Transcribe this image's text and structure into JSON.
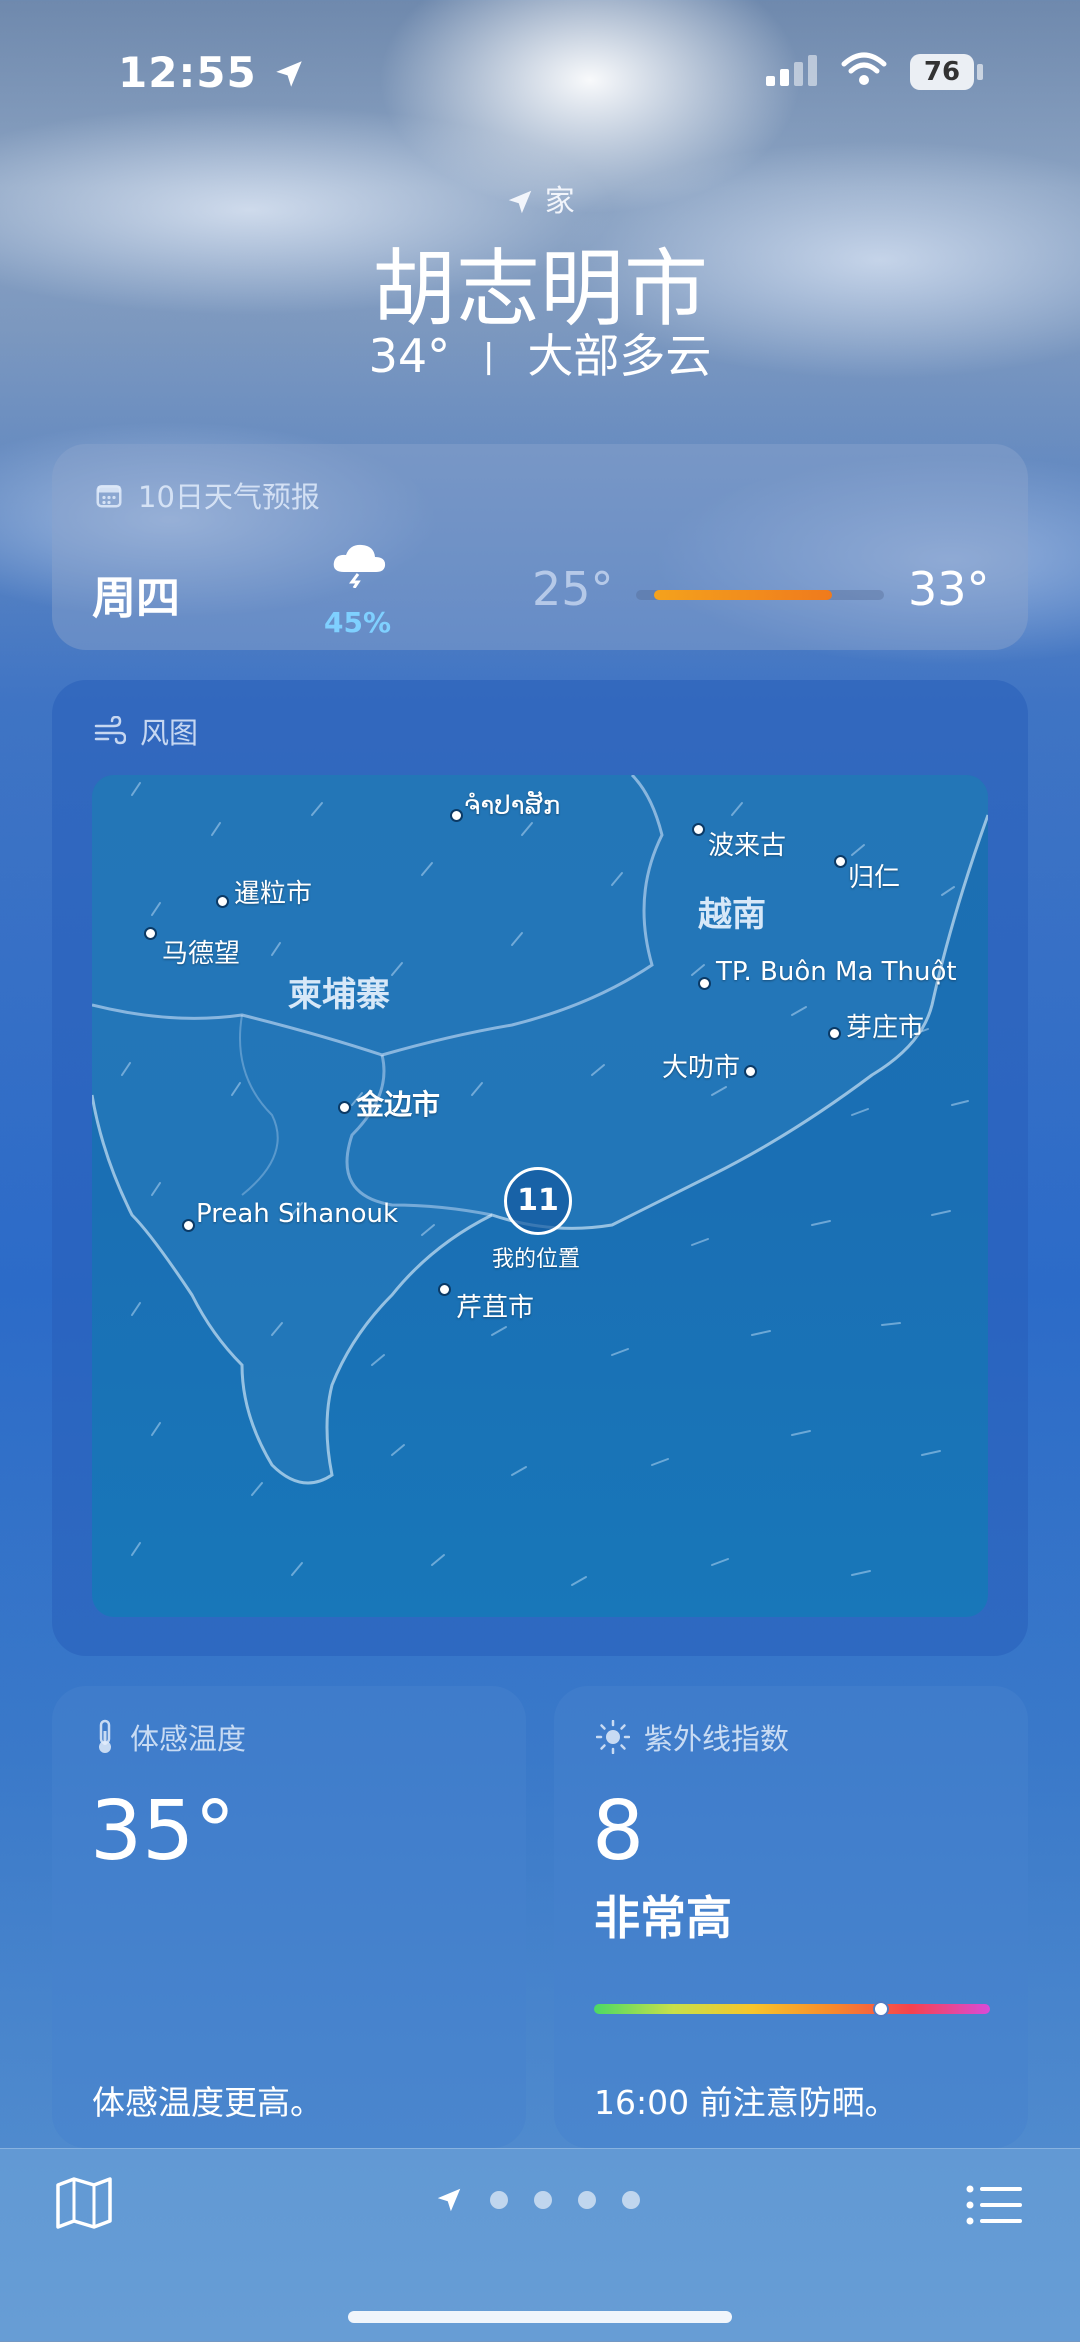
{
  "status_bar": {
    "time": "12:55",
    "battery": "76"
  },
  "header": {
    "location_label": "家",
    "city": "胡志明市",
    "temperature": "34°",
    "separator": "丨",
    "condition": "大部多云"
  },
  "forecast_card": {
    "title": "10日天气预报",
    "day": "周四",
    "precip": "45%",
    "low": "25°",
    "high": "33°",
    "icon": "cloud-rain-thunder-icon"
  },
  "wind_card": {
    "title": "风图",
    "labels": {
      "champasak": "ຈຳປາສັກ",
      "pleiku": "波来古",
      "quy_nhon": "归仁",
      "stung_treng": "暹粒市",
      "battambang": "马德望",
      "cambodia": "柬埔寨",
      "vietnam": "越南",
      "buon_ma_thuot": "TP. Buôn Ma Thuột",
      "nha_trang": "芽庄市",
      "da_lat": "大叻市",
      "phnom_penh": "金边市",
      "preah_sihanouk": "Preah Sihanouk",
      "can_tho": "芹苴市",
      "my_location_value": "11",
      "my_location": "我的位置"
    }
  },
  "feels_like_card": {
    "title": "体感温度",
    "value": "35°",
    "note": "体感温度更高。"
  },
  "uv_card": {
    "title": "紫外线指数",
    "value": "8",
    "level": "非常高",
    "note": "16:00 前注意防晒。",
    "uv_scale_position": 0.72
  },
  "colors": {
    "forecast_bar": "#f08a1c",
    "precip": "#7fd0ff"
  }
}
